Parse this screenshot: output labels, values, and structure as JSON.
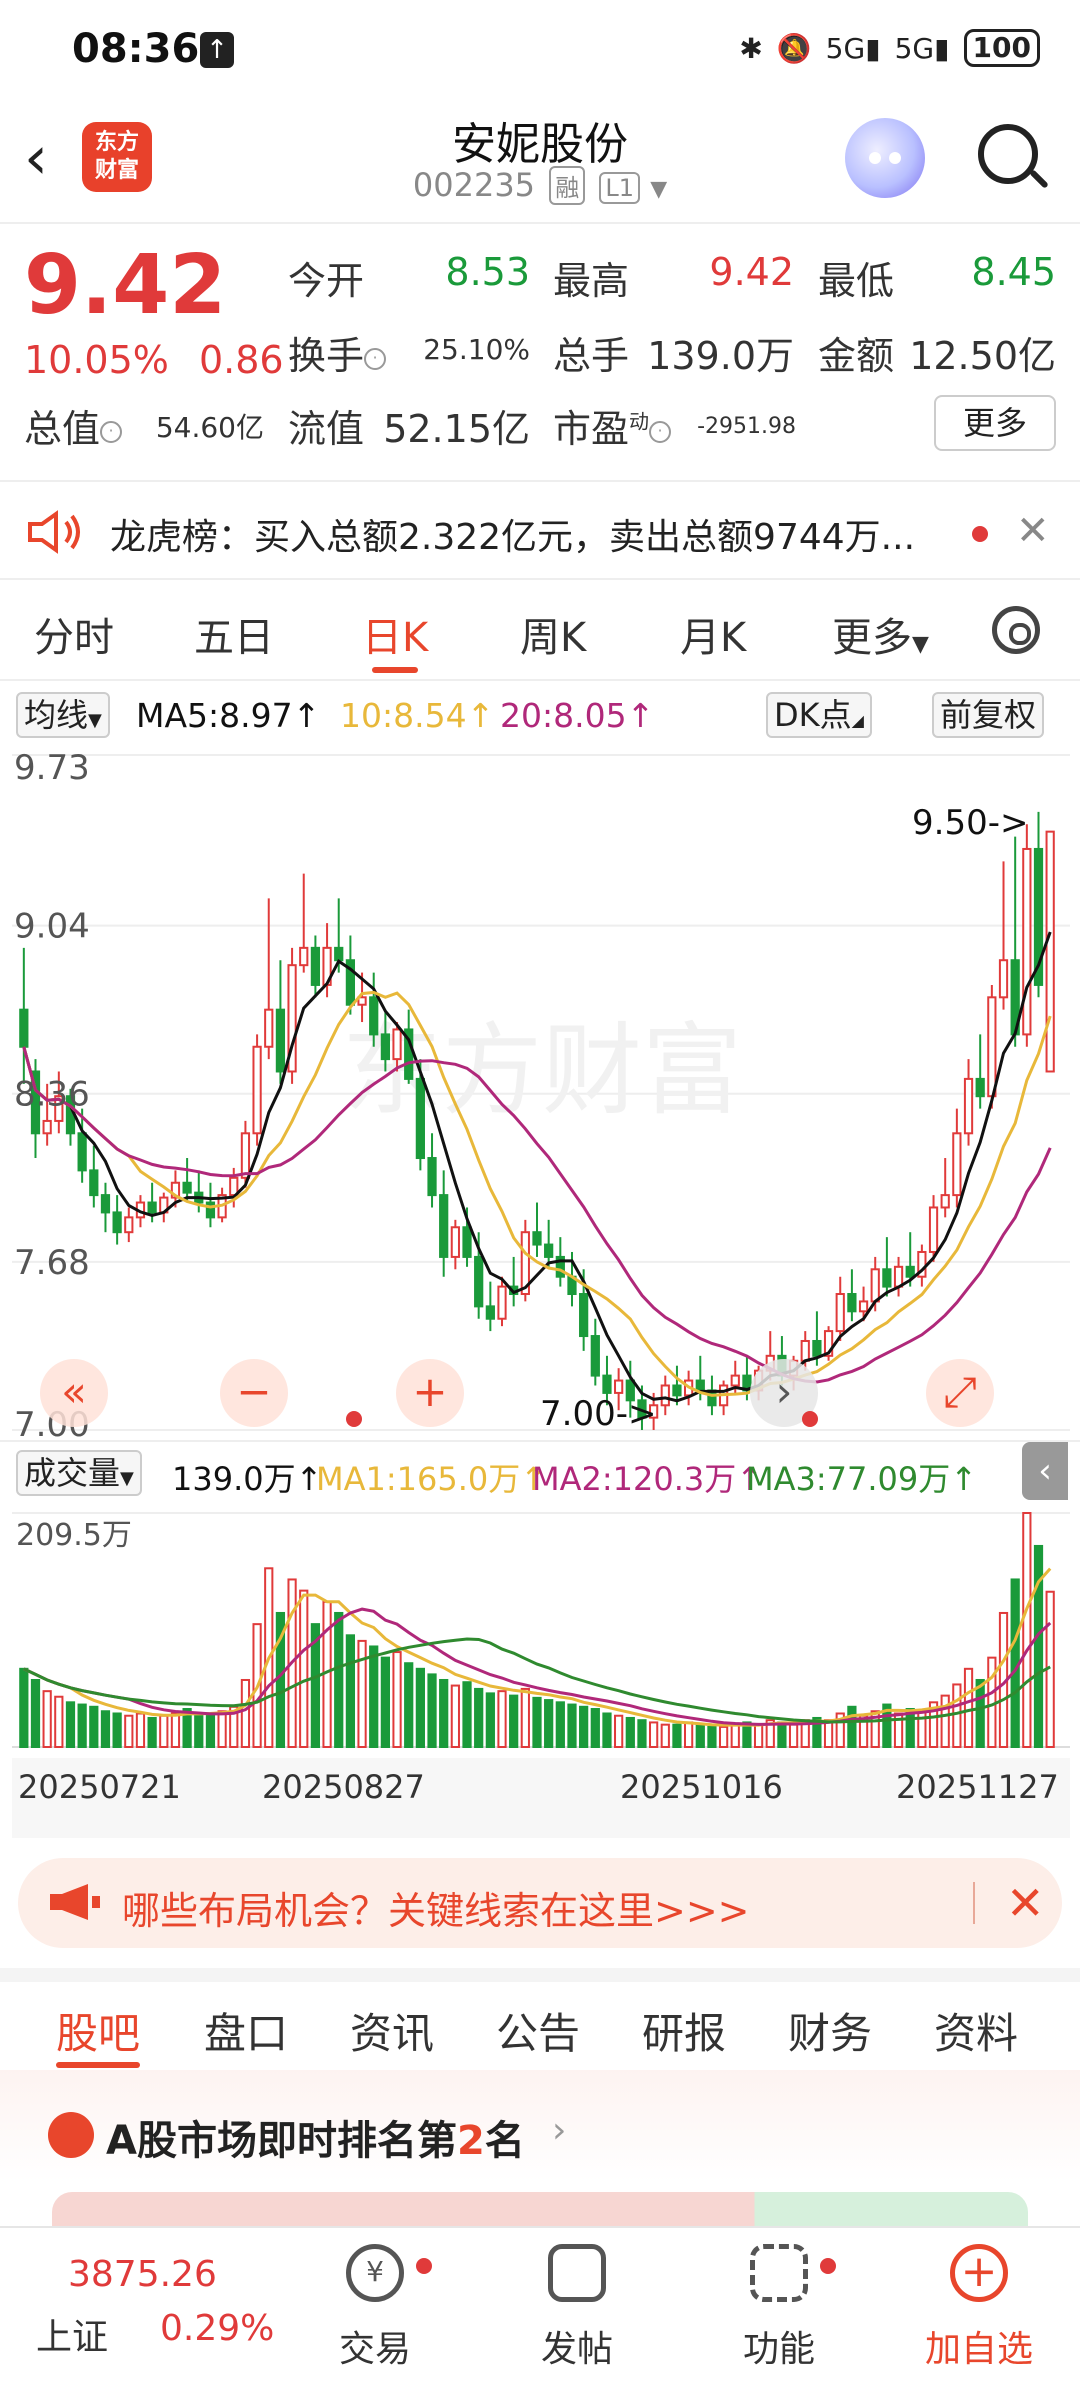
{
  "status_bar": {
    "time": "08:36",
    "network_1": "5G",
    "network_2": "5G",
    "battery": "100"
  },
  "header": {
    "title": "安妮股份",
    "code": "002235",
    "tag_margin": "融",
    "tag_level": "L1",
    "logo_text_1": "东方",
    "logo_text_2": "财富"
  },
  "quote": {
    "price": "9.42",
    "change_pct": "10.05%",
    "change_abs": "0.86",
    "open_label": "今开",
    "open": "8.53",
    "high_label": "最高",
    "high": "9.42",
    "low_label": "最低",
    "low": "8.45",
    "turnover_label": "换手",
    "turnover": "25.10%",
    "volume_label": "总手",
    "volume": "139.0万",
    "amount_label": "金额",
    "amount": "12.50亿",
    "mktcap_label": "总值",
    "mktcap": "54.60亿",
    "float_label": "流值",
    "float_cap": "52.15亿",
    "pe_label": "市盈",
    "pe_sup": "动",
    "pe": "-2951.98",
    "more_label": "更多"
  },
  "news": {
    "text": "龙虎榜：买入总额2.322亿元，卖出总额9744万..."
  },
  "chart_tabs": [
    "分时",
    "五日",
    "日K",
    "周K",
    "月K",
    "更多"
  ],
  "active_chart_tab": "日K",
  "ma_bar": {
    "selector": "均线",
    "ma5": "MA5:8.97↑",
    "ma10": "10:8.54↑",
    "ma20": "20:8.05↑",
    "dk": "DK点",
    "adjust": "前复权"
  },
  "volume_bar": {
    "selector": "成交量",
    "vol": "139.0万↑",
    "ma1": "MA1:165.0万↑",
    "ma2": "MA2:120.3万↑",
    "ma3": "MA3:77.09万↑",
    "max_label": "209.5万"
  },
  "chart_annotations": {
    "high_marker": "9.50->",
    "low_marker": "7.00->",
    "watermark": "东方财富"
  },
  "dates": [
    "20250721",
    "20250827",
    "20251016",
    "20251127"
  ],
  "colors": {
    "up": "#e03a3a",
    "down": "#1a9a3a",
    "ma5": "#111111",
    "ma10": "#e8b83a",
    "ma20": "#b0287a",
    "accent": "#e8462c",
    "vol_ma3": "#2f8a2f"
  },
  "chart_data": {
    "type": "candlestick",
    "ylim": [
      7.0,
      9.73
    ],
    "y_ticks": [
      "9.73",
      "9.04",
      "8.36",
      "7.68",
      "7.00"
    ],
    "candles": [
      [
        8.7,
        8.95,
        8.55,
        8.4
      ],
      [
        8.45,
        8.5,
        8.2,
        8.1
      ],
      [
        8.2,
        8.4,
        8.25,
        8.15
      ],
      [
        8.25,
        8.45,
        8.35,
        8.2
      ],
      [
        8.35,
        8.38,
        8.2,
        8.15
      ],
      [
        8.2,
        8.3,
        8.05,
        8.0
      ],
      [
        8.05,
        8.15,
        7.95,
        7.9
      ],
      [
        7.95,
        8.0,
        7.88,
        7.8
      ],
      [
        7.88,
        7.95,
        7.8,
        7.75
      ],
      [
        7.8,
        7.9,
        7.86,
        7.76
      ],
      [
        7.86,
        7.95,
        7.92,
        7.82
      ],
      [
        7.92,
        8.0,
        7.88,
        7.84
      ],
      [
        7.88,
        7.96,
        7.94,
        7.84
      ],
      [
        7.94,
        8.05,
        8.0,
        7.9
      ],
      [
        8.0,
        8.1,
        7.96,
        7.92
      ],
      [
        7.96,
        8.05,
        7.92,
        7.88
      ],
      [
        7.92,
        8.0,
        7.86,
        7.82
      ],
      [
        7.86,
        7.98,
        7.95,
        7.84
      ],
      [
        7.95,
        8.06,
        8.02,
        7.9
      ],
      [
        8.02,
        8.25,
        8.2,
        7.98
      ],
      [
        8.2,
        8.6,
        8.55,
        8.15
      ],
      [
        8.55,
        9.15,
        8.7,
        8.5
      ],
      [
        8.7,
        8.9,
        8.45,
        8.4
      ],
      [
        8.45,
        8.95,
        8.88,
        8.4
      ],
      [
        8.88,
        9.25,
        8.95,
        8.85
      ],
      [
        8.95,
        9.0,
        8.8,
        8.75
      ],
      [
        8.8,
        9.05,
        8.95,
        8.75
      ],
      [
        8.95,
        9.15,
        8.9,
        8.85
      ],
      [
        8.9,
        9.0,
        8.72,
        8.68
      ],
      [
        8.72,
        8.85,
        8.75,
        8.65
      ],
      [
        8.75,
        8.85,
        8.6,
        8.55
      ],
      [
        8.6,
        8.7,
        8.5,
        8.45
      ],
      [
        8.5,
        8.65,
        8.62,
        8.45
      ],
      [
        8.62,
        8.7,
        8.42,
        8.4
      ],
      [
        8.42,
        8.5,
        8.1,
        8.05
      ],
      [
        8.1,
        8.2,
        7.95,
        7.9
      ],
      [
        7.95,
        8.05,
        7.7,
        7.62
      ],
      [
        7.7,
        7.85,
        7.82,
        7.65
      ],
      [
        7.82,
        7.9,
        7.7,
        7.66
      ],
      [
        7.7,
        7.8,
        7.5,
        7.45
      ],
      [
        7.5,
        7.6,
        7.45,
        7.4
      ],
      [
        7.45,
        7.62,
        7.58,
        7.42
      ],
      [
        7.58,
        7.7,
        7.55,
        7.5
      ],
      [
        7.55,
        7.85,
        7.8,
        7.52
      ],
      [
        7.8,
        7.92,
        7.75,
        7.7
      ],
      [
        7.75,
        7.85,
        7.7,
        7.66
      ],
      [
        7.7,
        7.78,
        7.62,
        7.58
      ],
      [
        7.62,
        7.72,
        7.55,
        7.5
      ],
      [
        7.55,
        7.65,
        7.38,
        7.32
      ],
      [
        7.38,
        7.45,
        7.22,
        7.18
      ],
      [
        7.22,
        7.3,
        7.15,
        7.1
      ],
      [
        7.15,
        7.25,
        7.2,
        7.08
      ],
      [
        7.2,
        7.28,
        7.12,
        7.05
      ],
      [
        7.12,
        7.18,
        7.05,
        7.0
      ],
      [
        7.05,
        7.15,
        7.1,
        7.0
      ],
      [
        7.1,
        7.22,
        7.18,
        7.06
      ],
      [
        7.18,
        7.26,
        7.14,
        7.1
      ],
      [
        7.14,
        7.24,
        7.2,
        7.1
      ],
      [
        7.2,
        7.3,
        7.16,
        7.12
      ],
      [
        7.16,
        7.22,
        7.1,
        7.06
      ],
      [
        7.1,
        7.2,
        7.18,
        7.06
      ],
      [
        7.18,
        7.28,
        7.22,
        7.14
      ],
      [
        7.22,
        7.3,
        7.16,
        7.12
      ],
      [
        7.16,
        7.26,
        7.24,
        7.12
      ],
      [
        7.24,
        7.4,
        7.3,
        7.2
      ],
      [
        7.3,
        7.38,
        7.22,
        7.18
      ],
      [
        7.22,
        7.3,
        7.28,
        7.16
      ],
      [
        7.28,
        7.4,
        7.36,
        7.24
      ],
      [
        7.36,
        7.48,
        7.3,
        7.26
      ],
      [
        7.3,
        7.42,
        7.4,
        7.28
      ],
      [
        7.4,
        7.62,
        7.55,
        7.36
      ],
      [
        7.55,
        7.65,
        7.48,
        7.44
      ],
      [
        7.48,
        7.58,
        7.52,
        7.44
      ],
      [
        7.52,
        7.7,
        7.65,
        7.48
      ],
      [
        7.65,
        7.78,
        7.58,
        7.54
      ],
      [
        7.58,
        7.7,
        7.66,
        7.54
      ],
      [
        7.66,
        7.8,
        7.62,
        7.58
      ],
      [
        7.62,
        7.75,
        7.72,
        7.58
      ],
      [
        7.72,
        7.95,
        7.9,
        7.68
      ],
      [
        7.9,
        8.1,
        7.95,
        7.86
      ],
      [
        7.95,
        8.3,
        8.2,
        7.9
      ],
      [
        8.2,
        8.5,
        8.42,
        8.15
      ],
      [
        8.42,
        8.6,
        8.35,
        8.3
      ],
      [
        8.35,
        8.8,
        8.75,
        8.3
      ],
      [
        8.75,
        9.3,
        8.9,
        8.7
      ],
      [
        8.9,
        9.4,
        8.6,
        8.55
      ],
      [
        8.6,
        9.45,
        9.35,
        8.55
      ],
      [
        9.35,
        9.5,
        8.8,
        8.75
      ],
      [
        8.45,
        9.42,
        9.42,
        8.45
      ]
    ],
    "volumes": [
      70,
      60,
      50,
      45,
      40,
      38,
      36,
      32,
      30,
      28,
      30,
      26,
      28,
      30,
      34,
      30,
      28,
      32,
      36,
      60,
      110,
      160,
      120,
      150,
      140,
      110,
      130,
      120,
      100,
      95,
      90,
      80,
      85,
      75,
      70,
      65,
      60,
      55,
      58,
      52,
      48,
      50,
      46,
      52,
      44,
      42,
      40,
      38,
      36,
      34,
      30,
      28,
      26,
      24,
      22,
      20,
      20,
      22,
      20,
      18,
      18,
      20,
      22,
      20,
      24,
      22,
      20,
      24,
      26,
      24,
      30,
      36,
      28,
      32,
      38,
      30,
      34,
      32,
      40,
      46,
      56,
      70,
      60,
      80,
      120,
      150,
      209.5,
      180,
      139
    ],
    "vol_ylim": [
      0,
      209.5
    ],
    "x_tick_labels": [
      "20250721",
      "20250827",
      "20251016",
      "20251127"
    ]
  },
  "banner": {
    "text": "哪些布局机会？关键线索在这里>>>"
  },
  "bottom_tabs": [
    "股吧",
    "盘口",
    "资讯",
    "公告",
    "研报",
    "财务",
    "资料"
  ],
  "rank": {
    "prefix": "A股市场即时排名第",
    "num": "2",
    "suffix": "名"
  },
  "bottom_nav": {
    "index_value": "3875.26",
    "index_name": "上证",
    "index_pct": "0.29%",
    "items": [
      "交易",
      "发帖",
      "功能",
      "加自选"
    ]
  }
}
